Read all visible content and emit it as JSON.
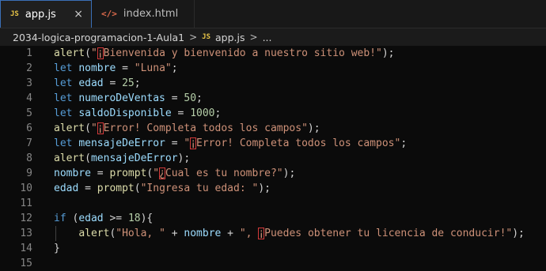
{
  "tabs": [
    {
      "icon": "JS",
      "label": "app.js",
      "close": "×"
    },
    {
      "icon": "</>",
      "label": "index.html"
    }
  ],
  "breadcrumb": {
    "folder": "2034-logica-programacion-1-Aula1",
    "sep1": ">",
    "file_icon": "JS",
    "file": "app.js",
    "sep2": ">",
    "tail": "..."
  },
  "editor": {
    "line_numbers": [
      "1",
      "2",
      "3",
      "4",
      "5",
      "6",
      "7",
      "8",
      "9",
      "10",
      "11",
      "12",
      "13",
      "14",
      "15"
    ],
    "lines": [
      [
        [
          "fn",
          "alert"
        ],
        [
          "p",
          "("
        ],
        [
          "str",
          "\""
        ],
        [
          "hl",
          "¡"
        ],
        [
          "str",
          "Bienvenida y bienvenido a nuestro sitio web!\""
        ],
        [
          "p",
          ");"
        ]
      ],
      [
        [
          "kw",
          "let "
        ],
        [
          "var",
          "nombre"
        ],
        [
          "op",
          " = "
        ],
        [
          "str",
          "\"Luna\""
        ],
        [
          "p",
          ";"
        ]
      ],
      [
        [
          "kw",
          "let "
        ],
        [
          "var",
          "edad"
        ],
        [
          "op",
          " = "
        ],
        [
          "num",
          "25"
        ],
        [
          "p",
          ";"
        ]
      ],
      [
        [
          "kw",
          "let "
        ],
        [
          "var",
          "numeroDeVentas"
        ],
        [
          "op",
          " = "
        ],
        [
          "num",
          "50"
        ],
        [
          "p",
          ";"
        ]
      ],
      [
        [
          "kw",
          "let "
        ],
        [
          "var",
          "saldoDisponible"
        ],
        [
          "op",
          " = "
        ],
        [
          "num",
          "1000"
        ],
        [
          "p",
          ";"
        ]
      ],
      [
        [
          "fn",
          "alert"
        ],
        [
          "p",
          "("
        ],
        [
          "str",
          "\""
        ],
        [
          "hl",
          "¡"
        ],
        [
          "str",
          "Error! Completa todos los campos\""
        ],
        [
          "p",
          ");"
        ]
      ],
      [
        [
          "kw",
          "let "
        ],
        [
          "var",
          "mensajeDeError"
        ],
        [
          "op",
          " = "
        ],
        [
          "str",
          "\""
        ],
        [
          "hl",
          "¡"
        ],
        [
          "str",
          "Error! Completa todos los campos\""
        ],
        [
          "p",
          ";"
        ]
      ],
      [
        [
          "fn",
          "alert"
        ],
        [
          "p",
          "("
        ],
        [
          "var",
          "mensajeDeError"
        ],
        [
          "p",
          ");"
        ]
      ],
      [
        [
          "var",
          "nombre"
        ],
        [
          "op",
          " = "
        ],
        [
          "fn",
          "prompt"
        ],
        [
          "p",
          "("
        ],
        [
          "str",
          "\""
        ],
        [
          "hl",
          "¿"
        ],
        [
          "str",
          "Cual es tu nombre?\""
        ],
        [
          "p",
          ");"
        ]
      ],
      [
        [
          "var",
          "edad"
        ],
        [
          "op",
          " = "
        ],
        [
          "fn",
          "prompt"
        ],
        [
          "p",
          "("
        ],
        [
          "str",
          "\"Ingresa tu edad: \""
        ],
        [
          "p",
          ");"
        ]
      ],
      [],
      [
        [
          "kw",
          "if "
        ],
        [
          "p",
          "("
        ],
        [
          "var",
          "edad"
        ],
        [
          "op",
          " >= "
        ],
        [
          "num",
          "18"
        ],
        [
          "p",
          "){"
        ]
      ],
      [
        [
          "p",
          "    "
        ],
        [
          "fn",
          "alert"
        ],
        [
          "p",
          "("
        ],
        [
          "str",
          "\"Hola, \""
        ],
        [
          "op",
          " + "
        ],
        [
          "var",
          "nombre"
        ],
        [
          "op",
          " + "
        ],
        [
          "str",
          "\", "
        ],
        [
          "hl",
          "¡"
        ],
        [
          "str",
          "Puedes obtener tu licencia de conducir!\""
        ],
        [
          "p",
          ");"
        ]
      ],
      [
        [
          "p",
          "}"
        ]
      ],
      []
    ]
  },
  "colors": {
    "keyword": "#569cd6",
    "function": "#dcdcaa",
    "variable": "#9cdcfe",
    "string": "#ce9178",
    "number": "#b5cea8",
    "highlight_border": "#d43a3a",
    "active_tab_border": "#3b6fb6"
  }
}
